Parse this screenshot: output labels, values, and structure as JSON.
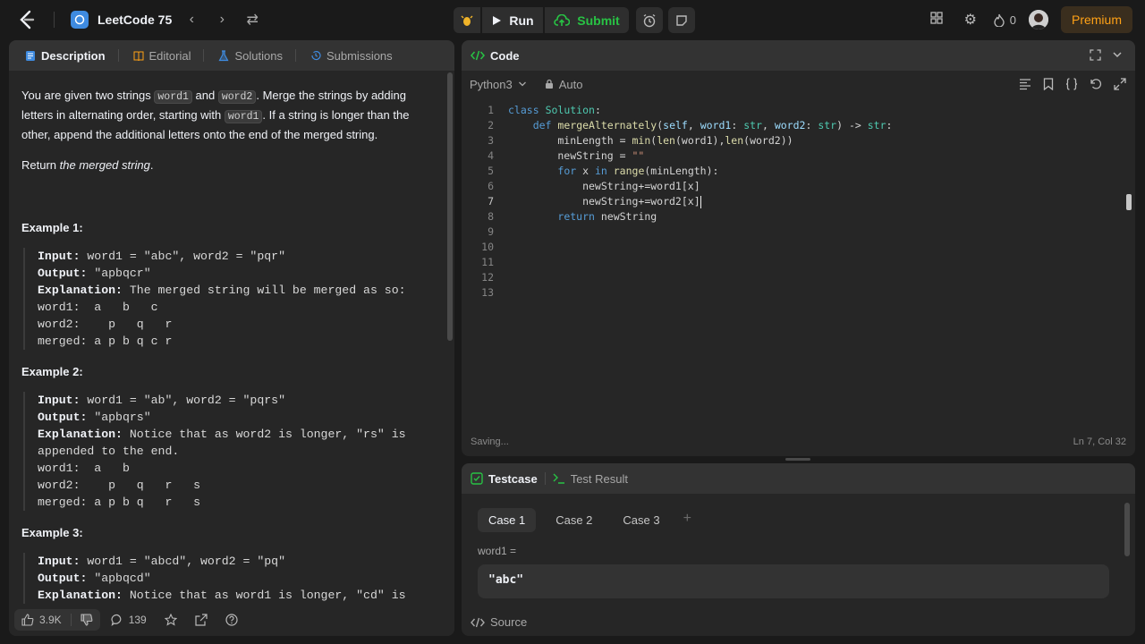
{
  "topbar": {
    "title": "LeetCode 75",
    "run_label": "Run",
    "submit_label": "Submit",
    "streak_count": "0",
    "premium_label": "Premium"
  },
  "left_panel": {
    "tabs": [
      {
        "label": "Description"
      },
      {
        "label": "Editorial"
      },
      {
        "label": "Solutions"
      },
      {
        "label": "Submissions"
      }
    ],
    "desc": {
      "p1_a": "You are given two strings ",
      "word1": "word1",
      "p1_b": " and ",
      "word2": "word2",
      "p1_c": ". Merge the strings by adding letters in alternating order, starting with ",
      "p1_d": ". If a string is longer than the other, append the additional letters onto the end of the merged string.",
      "p2_a": "Return ",
      "p2_b": "the merged string",
      "p2_c": "."
    },
    "examples": [
      {
        "heading": "Example 1:",
        "input_label": "Input:",
        "input": " word1 = \"abc\", word2 = \"pqr\"",
        "output_label": "Output:",
        "output": " \"apbqcr\"",
        "expl_label": "Explanation:",
        "expl": " The merged string will be merged as so:",
        "lines": [
          "word1:  a   b   c",
          "word2:    p   q   r",
          "merged: a p b q c r"
        ]
      },
      {
        "heading": "Example 2:",
        "input_label": "Input:",
        "input": " word1 = \"ab\", word2 = \"pqrs\"",
        "output_label": "Output:",
        "output": " \"apbqrs\"",
        "expl_label": "Explanation:",
        "expl": " Notice that as word2 is longer, \"rs\" is appended to the end.",
        "lines": [
          "word1:  a   b",
          "word2:    p   q   r   s",
          "merged: a p b q   r   s"
        ]
      },
      {
        "heading": "Example 3:",
        "input_label": "Input:",
        "input": " word1 = \"abcd\", word2 = \"pq\"",
        "output_label": "Output:",
        "output": " \"apbqcd\"",
        "expl_label": "Explanation:",
        "expl": " Notice that as word1 is longer, \"cd\" is"
      }
    ],
    "footer": {
      "likes": "3.9K",
      "comments": "139"
    }
  },
  "editor": {
    "tab_label": "Code",
    "language": "Python3",
    "mode": "Auto",
    "status": "Saving...",
    "cursor_pos": "Ln 7, Col 32",
    "line_numbers": [
      "1",
      "2",
      "3",
      "4",
      "5",
      "6",
      "7",
      "8",
      "9",
      "10",
      "11",
      "12",
      "13"
    ]
  },
  "testcase": {
    "tab_testcase": "Testcase",
    "tab_result": "Test Result",
    "cases": [
      "Case 1",
      "Case 2",
      "Case 3"
    ],
    "var_label": "word1 =",
    "var_value": "\"abc\"",
    "source_label": "Source"
  }
}
